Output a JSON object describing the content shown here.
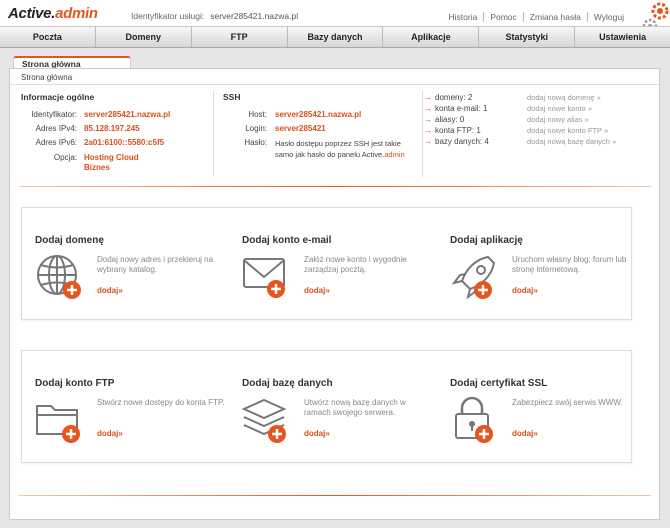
{
  "header": {
    "logo_main": "Active.",
    "logo_accent": "admin",
    "service_label": "Identyfikator usługi:",
    "service_value": "server285421.nazwa.pl",
    "links": [
      "Historia",
      "Pomoc",
      "Zmiana hasła",
      "Wyloguj"
    ]
  },
  "nav": {
    "tabs": [
      "Poczta",
      "Domeny",
      "FTP",
      "Bazy danych",
      "Aplikacje",
      "Statystyki",
      "Ustawienia"
    ]
  },
  "breadcrumb": {
    "tab_label": "Strona główna",
    "path": "Strona główna"
  },
  "general": {
    "title": "Informacje ogólne",
    "rows": [
      {
        "label": "Identyfikator:",
        "value": "server285421.nazwa.pl"
      },
      {
        "label": "Adres IPv4:",
        "value": "85.128.197.245"
      },
      {
        "label": "Adres IPv6:",
        "value": "2a01:6100::5580:c5f5"
      },
      {
        "label": "Opcja:",
        "value": "Hosting Cloud",
        "value2": "Biznes"
      }
    ]
  },
  "ssh": {
    "title": "SSH",
    "host_label": "Host:",
    "host_value": "server285421.nazwa.pl",
    "login_label": "Login:",
    "login_value": "server285421",
    "pass_label": "Hasło:",
    "pass_note": "Hasło dostępu poprzez SSH jest takie samo jak hasło do panelu Active.",
    "pass_note_accent": "admin"
  },
  "stats": [
    {
      "text": "domeny: 2",
      "link": "dodaj nową domenę »"
    },
    {
      "text": "konta e-mail: 1",
      "link": "dodaj nowe konto »"
    },
    {
      "text": "aliasy: 0",
      "link": "dodaj nowy alias »"
    },
    {
      "text": "konta FTP: 1",
      "link": "dodaj nowe konto FTP »"
    },
    {
      "text": "bazy danych: 4",
      "link": "dodaj nową bazę danych »"
    }
  ],
  "cards": [
    {
      "title": "Dodaj domenę",
      "desc": "Dodaj nowy adres i przekieruj na wybrany katalog.",
      "link": "dodaj»",
      "icon": "globe-icon"
    },
    {
      "title": "Dodaj konto e-mail",
      "desc": "Załóż nowe konto i wygodnie zarządzaj pocztą.",
      "link": "dodaj»",
      "icon": "envelope-icon"
    },
    {
      "title": "Dodaj aplikację",
      "desc": "Uruchom własny blog, forum lub stronę internetową.",
      "link": "dodaj»",
      "icon": "rocket-icon"
    },
    {
      "title": "Dodaj konto FTP",
      "desc": "Stwórz nowe dostępy do konta FTP.",
      "link": "dodaj»",
      "icon": "folder-icon"
    },
    {
      "title": "Dodaj bazę danych",
      "desc": "Utwórz nową bazę danych w ramach swojego serwera.",
      "link": "dodaj»",
      "icon": "database-layers-icon"
    },
    {
      "title": "Dodaj certyfikat SSL",
      "desc": "Zabezpiecz swój serwis WWW.",
      "link": "dodaj»",
      "icon": "padlock-icon"
    }
  ],
  "colors": {
    "accent": "#e8541e",
    "link_value": "#d9501d",
    "icon_gray": "#777777"
  }
}
